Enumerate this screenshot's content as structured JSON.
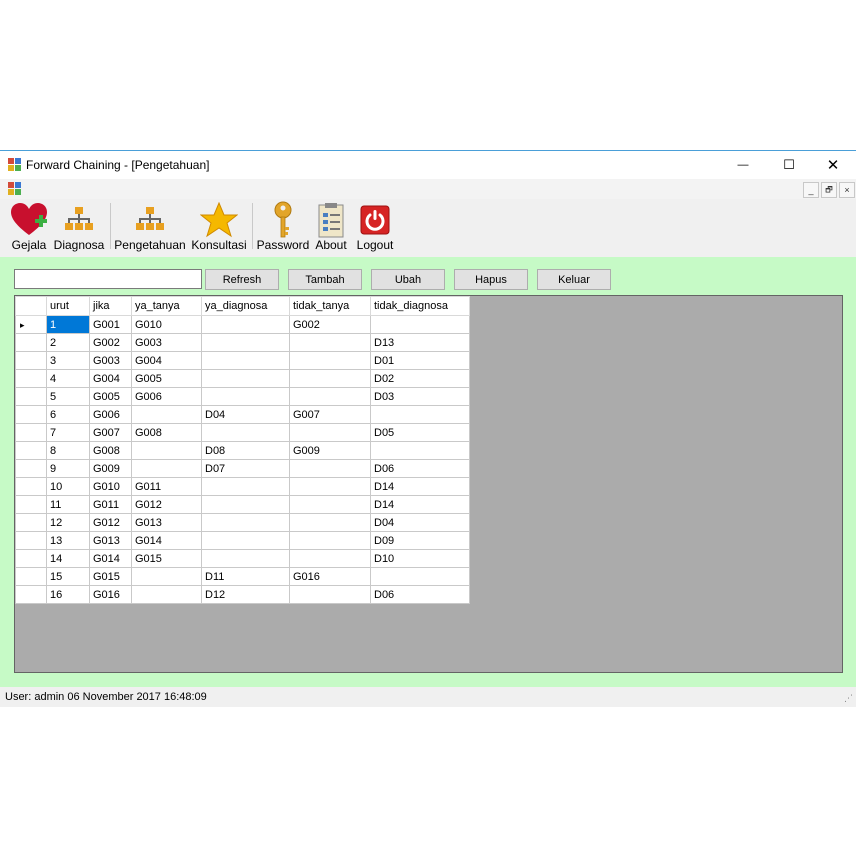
{
  "window": {
    "title": "Forward Chaining - [Pengetahuan]",
    "minimize": "—",
    "maximize": "☐",
    "close": "✕"
  },
  "mdi": {
    "minimize": "_",
    "restore": "🗗",
    "close": "×"
  },
  "toolbar": {
    "items": [
      {
        "label": "Gejala",
        "icon": "heart-plus-icon"
      },
      {
        "label": "Diagnosa",
        "icon": "org-chart-icon"
      },
      {
        "label": "Pengetahuan",
        "icon": "org-chart-icon"
      },
      {
        "label": "Konsultasi",
        "icon": "star-icon"
      },
      {
        "label": "Password",
        "icon": "key-icon"
      },
      {
        "label": "About",
        "icon": "document-icon"
      },
      {
        "label": "Logout",
        "icon": "power-icon"
      }
    ]
  },
  "form": {
    "search": {
      "value": "",
      "placeholder": ""
    },
    "buttons": {
      "refresh": "Refresh",
      "tambah": "Tambah",
      "ubah": "Ubah",
      "hapus": "Hapus",
      "keluar": "Keluar"
    }
  },
  "grid": {
    "columns": [
      "urut",
      "jika",
      "ya_tanya",
      "ya_diagnosa",
      "tidak_tanya",
      "tidak_diagnosa"
    ],
    "current_row_marker": "▸",
    "rows": [
      [
        "1",
        "G001",
        "G010",
        "",
        "G002",
        ""
      ],
      [
        "2",
        "G002",
        "G003",
        "",
        "",
        "D13"
      ],
      [
        "3",
        "G003",
        "G004",
        "",
        "",
        "D01"
      ],
      [
        "4",
        "G004",
        "G005",
        "",
        "",
        "D02"
      ],
      [
        "5",
        "G005",
        "G006",
        "",
        "",
        "D03"
      ],
      [
        "6",
        "G006",
        "",
        "D04",
        "G007",
        ""
      ],
      [
        "7",
        "G007",
        "G008",
        "",
        "",
        "D05"
      ],
      [
        "8",
        "G008",
        "",
        "D08",
        "G009",
        ""
      ],
      [
        "9",
        "G009",
        "",
        "D07",
        "",
        "D06"
      ],
      [
        "10",
        "G010",
        "G011",
        "",
        "",
        "D14"
      ],
      [
        "11",
        "G011",
        "G012",
        "",
        "",
        "D14"
      ],
      [
        "12",
        "G012",
        "G013",
        "",
        "",
        "D04"
      ],
      [
        "13",
        "G013",
        "G014",
        "",
        "",
        "D09"
      ],
      [
        "14",
        "G014",
        "G015",
        "",
        "",
        "D10"
      ],
      [
        "15",
        "G015",
        "",
        "D11",
        "G016",
        ""
      ],
      [
        "16",
        "G016",
        "",
        "D12",
        "",
        "D06"
      ]
    ]
  },
  "status": {
    "text": "User: admin  06 November 2017 16:48:09"
  },
  "colors": {
    "background_panel": "#c6fac6",
    "selection": "#0078d7",
    "grid_background": "#ababab"
  }
}
